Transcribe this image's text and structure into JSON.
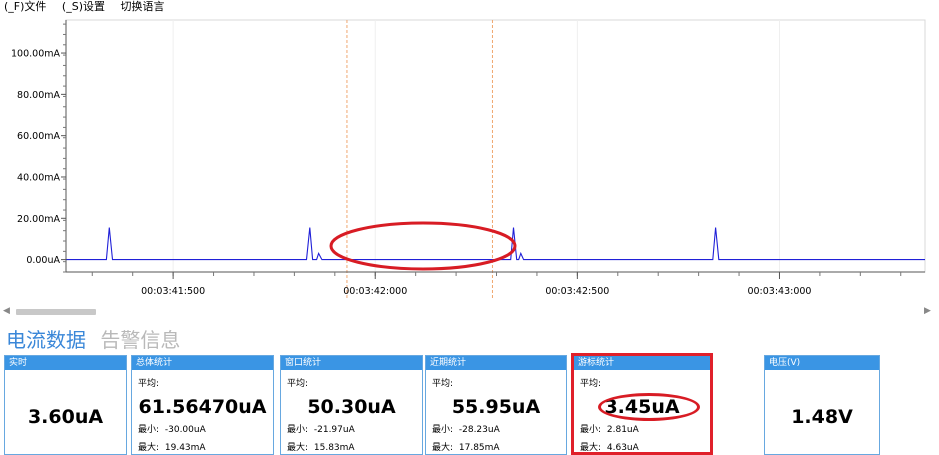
{
  "menu": {
    "file": "(_F)文件",
    "settings": "(_S)设置",
    "language": "切换语言"
  },
  "chart_data": {
    "type": "line",
    "title": "",
    "xlabel": "",
    "ylabel": "",
    "y_tick_labels": [
      "100.00mA",
      "80.00mA",
      "60.00mA",
      "40.00mA",
      "20.00mA",
      "0.00uA"
    ],
    "y_tick_values_mA": [
      100,
      80,
      60,
      40,
      20,
      0
    ],
    "ylim_mA": [
      -6,
      116
    ],
    "x_tick_labels": [
      "00:03:41:500",
      "00:03:42:000",
      "00:03:42:500",
      "00:03:43:000"
    ],
    "x_tick_values_s": [
      221.5,
      222.0,
      222.5,
      223.0
    ],
    "xlim_s": [
      221.235,
      223.36
    ],
    "grid": true,
    "cursors_s": [
      221.93,
      222.29
    ],
    "line_color": "#2020d8",
    "cursor_color": "#f0a870",
    "series": [
      {
        "x": [
          221.235,
          221.32,
          221.335,
          221.342,
          221.35,
          221.365,
          221.815,
          221.83,
          221.838,
          221.845,
          221.855,
          221.86,
          221.868,
          221.88,
          222.32,
          222.335,
          222.342,
          222.35,
          222.355,
          222.36,
          222.367,
          222.38,
          222.82,
          222.835,
          222.842,
          222.85,
          222.865,
          223.36
        ],
        "y": [
          0,
          0,
          0,
          15.5,
          0,
          0,
          0,
          0,
          15.5,
          0,
          0,
          3,
          0,
          0,
          0,
          0,
          15.5,
          0,
          0,
          3,
          0,
          0,
          0,
          0,
          15.5,
          0,
          0,
          0
        ]
      }
    ]
  },
  "tabs": {
    "active": "电流数据",
    "inactive": "告警信息"
  },
  "panels": {
    "realtime": {
      "title": "实时",
      "value": "3.60uA"
    },
    "total": {
      "title": "总体统计",
      "avg_label": "平均:",
      "value": "61.56470uA",
      "min_label": "最小:",
      "min": "-30.00uA",
      "max_label": "最大:",
      "max": "19.43mA"
    },
    "window": {
      "title": "窗口统计",
      "avg_label": "平均:",
      "value": "50.30uA",
      "min_label": "最小:",
      "min": "-21.97uA",
      "max_label": "最大:",
      "max": "15.83mA"
    },
    "recent": {
      "title": "近期统计",
      "avg_label": "平均:",
      "value": "55.95uA",
      "min_label": "最小:",
      "min": "-28.23uA",
      "max_label": "最大:",
      "max": "17.85mA"
    },
    "cursor": {
      "title": "游标统计",
      "avg_label": "平均:",
      "value": "3.45uA",
      "min_label": "最小:",
      "min": "2.81uA",
      "max_label": "最大:",
      "max": "4.63uA"
    },
    "voltage": {
      "title": "电压(V)",
      "value": "1.48V"
    }
  },
  "annotation_color": "#d81c24"
}
